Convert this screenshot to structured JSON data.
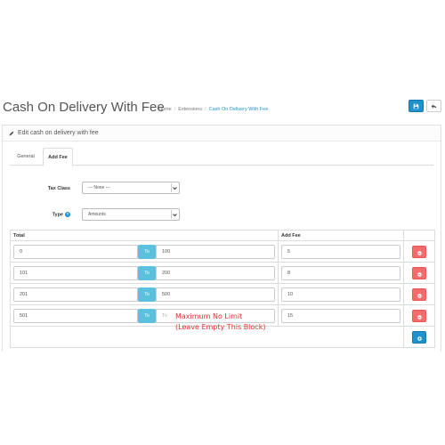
{
  "header": {
    "title": "Cash On Delivery With Fee",
    "breadcrumb": [
      "Home",
      "Extensions",
      "Cash On Delivery With Fee"
    ]
  },
  "panel": {
    "heading": "Edit cash on delivery with fee",
    "tabs": [
      {
        "label": "General",
        "active": false
      },
      {
        "label": "Add Fee",
        "active": true
      }
    ]
  },
  "form": {
    "tax_class_label": "Tax Class",
    "tax_class_value": "--- None ---",
    "type_label": "Type",
    "type_value": "Amounts"
  },
  "table": {
    "headers": [
      "Total",
      "Add Fee"
    ],
    "to_label": "To",
    "rows": [
      {
        "from": "0",
        "to": "100",
        "fee": "5"
      },
      {
        "from": "101",
        "to": "200",
        "fee": "8"
      },
      {
        "from": "201",
        "to": "500",
        "fee": "10"
      },
      {
        "from": "501",
        "to": "To",
        "fee": "15"
      }
    ]
  },
  "note": {
    "line1": "Maximum No Limit",
    "line2": "(Leave Empty This Block)"
  },
  "colors": {
    "primary": "#1e91cf",
    "danger": "#f56b6b",
    "info": "#5bc0de",
    "note": "#e3302f"
  },
  "icons": {
    "save": "save-icon",
    "back": "reply-icon",
    "edit": "pencil-icon",
    "delete": "minus-circle-icon",
    "add": "plus-circle-icon"
  }
}
